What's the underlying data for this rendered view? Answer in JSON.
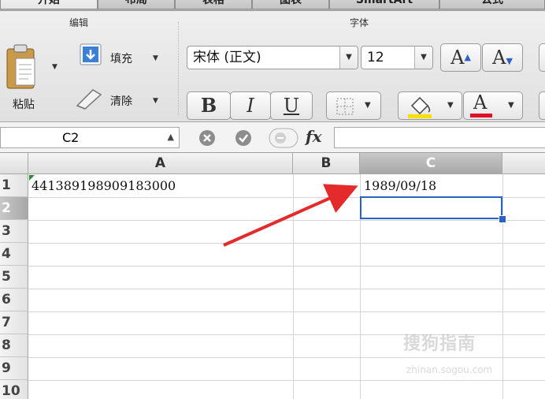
{
  "tabs": [
    "开始",
    "布局",
    "表格",
    "图表",
    "SmartArt",
    "公式"
  ],
  "ribbon": {
    "edit_group": "编辑",
    "font_group": "字体",
    "paste": "粘贴",
    "fill": "填充",
    "clear": "清除",
    "font_name": "宋体 (正文)",
    "font_size": "12",
    "grow_font": "A",
    "shrink_font": "A",
    "bold": "B",
    "italic": "I",
    "underline": "U",
    "font_color_letter": "A",
    "highlight_color": "#f5e000",
    "font_color": "#e0102a"
  },
  "formula_bar": {
    "name_box": "C2",
    "fx": "fx",
    "value": ""
  },
  "sheet": {
    "columns": [
      "A",
      "B",
      "C"
    ],
    "selected_column": "C",
    "rows": [
      "1",
      "2",
      "3",
      "4",
      "5",
      "6",
      "7",
      "8",
      "9",
      "10"
    ],
    "selected_row": "2",
    "active_cell": "C2",
    "cells": {
      "A1": "441389198909183000",
      "C1": "1989/09/18"
    }
  },
  "watermark": {
    "brand": "搜狗指南",
    "url": "zhinan.sogou.com"
  },
  "colors": {
    "selection": "#2a62c6",
    "annotation_arrow": "#e32b2b"
  }
}
